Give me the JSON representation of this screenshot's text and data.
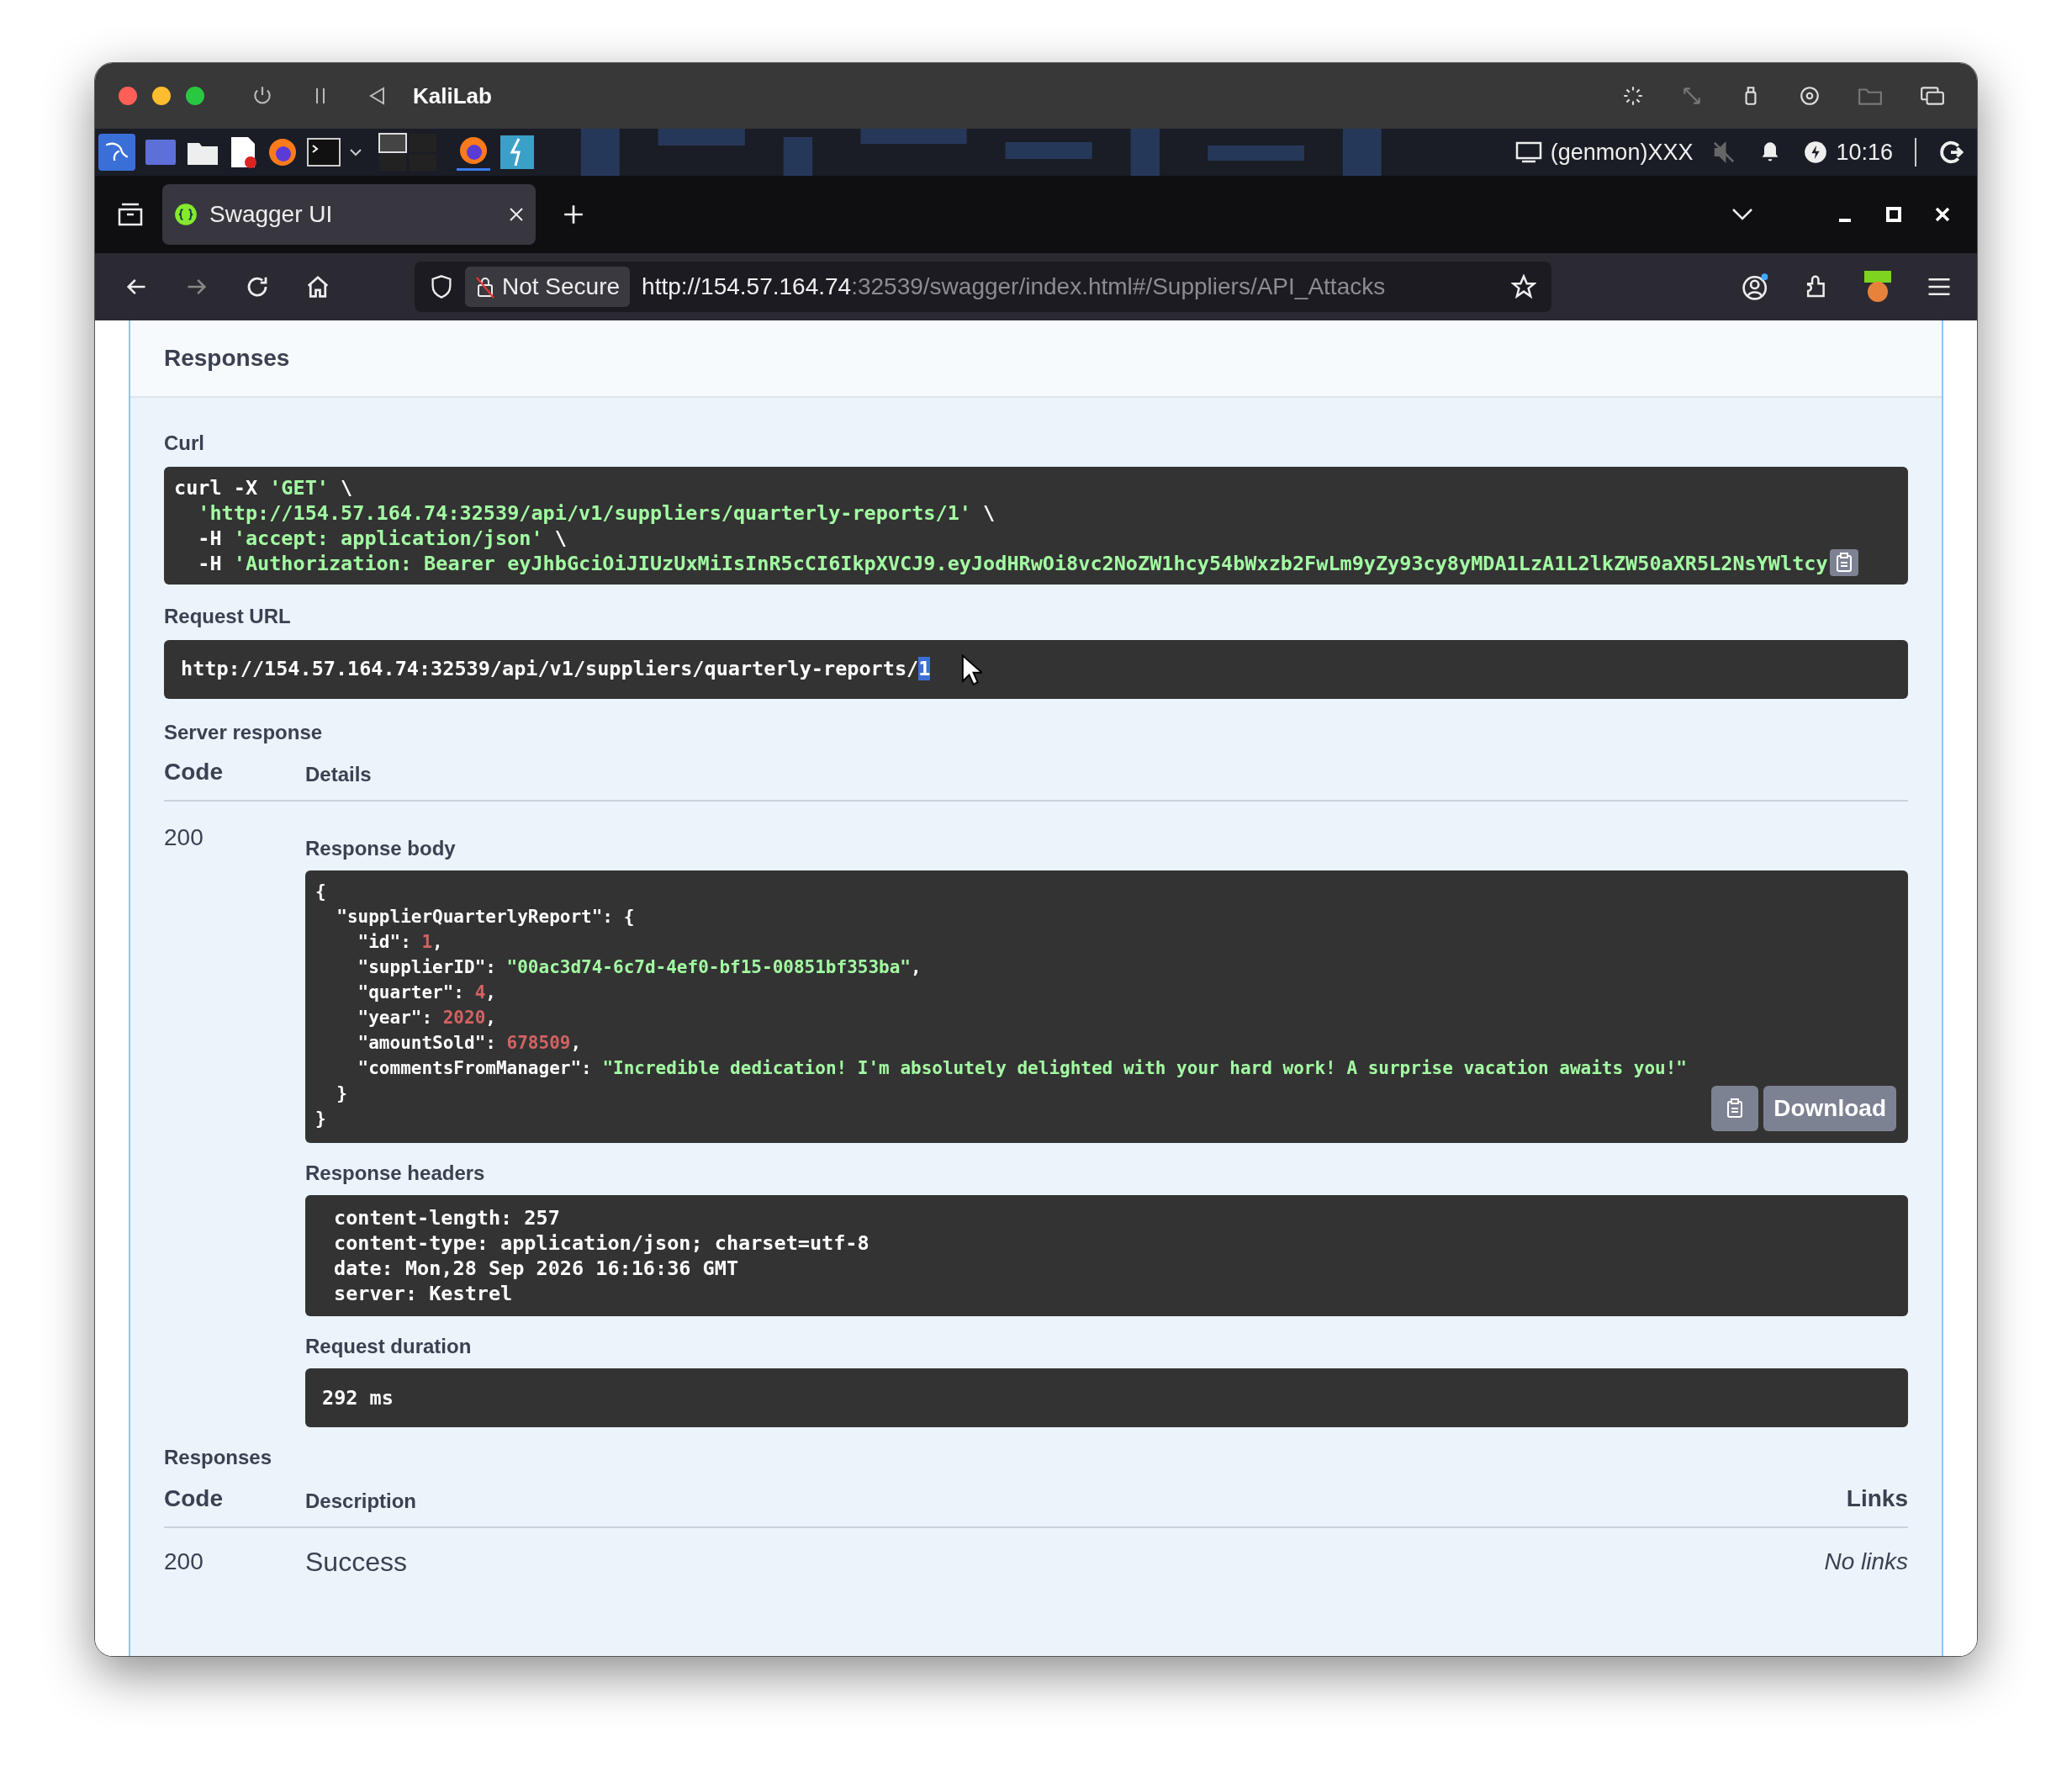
{
  "window": {
    "title": "KaliLab"
  },
  "taskbar": {
    "indicator": "(genmon)XXX",
    "clock": "10:16"
  },
  "browser": {
    "tabs": [
      {
        "title": "Swagger UI",
        "selected": true
      }
    ],
    "url": {
      "security": "Not Secure",
      "host": "http://154.57.164.74",
      "rest": ":32539/swagger/index.html#/Suppliers/API_Attacks"
    }
  },
  "section_title": "Responses",
  "curl": {
    "label": "Curl",
    "lines": [
      [
        {
          "text": "curl -X ",
          "kind": "plain"
        },
        {
          "text": "'GET'",
          "kind": "string"
        },
        {
          "text": " \\",
          "kind": "plain"
        }
      ],
      [
        {
          "text": "  'http://154.57.164.74:32539/api/v1/suppliers/quarterly-reports/1'",
          "kind": "string"
        },
        {
          "text": " \\",
          "kind": "plain"
        }
      ],
      [
        {
          "text": "  -H ",
          "kind": "plain"
        },
        {
          "text": "'accept: application/json'",
          "kind": "string"
        },
        {
          "text": " \\",
          "kind": "plain"
        }
      ],
      [
        {
          "text": "  -H ",
          "kind": "plain"
        },
        {
          "text": "'Authorization: Bearer eyJhbGciOiJIUzUxMiIsInR5cCI6IkpXVCJ9.eyJodHRwOi8vc2NoZW1hcy54bWxzb2FwLm9yZy93cy8yMDA1LzA1L2lkZW50aXR5L2NsYWltcy",
          "kind": "string"
        }
      ]
    ]
  },
  "request_url": {
    "label": "Request URL",
    "parts": [
      {
        "text": "http://154.57.164.74:32539/api/v1/suppliers/quarterly-reports/",
        "selected": false
      },
      {
        "text": "1",
        "selected": true
      }
    ]
  },
  "server_response": {
    "label": "Server response",
    "columns": [
      "Code",
      "Details"
    ],
    "code": "200",
    "body": {
      "label": "Response body",
      "download": "Download",
      "lines": [
        [
          {
            "text": "{",
            "kind": "plain"
          }
        ],
        [
          {
            "text": "  \"supplierQuarterlyReport\": {",
            "kind": "plain"
          }
        ],
        [
          {
            "text": "    \"id\": ",
            "kind": "plain"
          },
          {
            "text": "1",
            "kind": "number"
          },
          {
            "text": ",",
            "kind": "plain"
          }
        ],
        [
          {
            "text": "    \"supplierID\": ",
            "kind": "plain"
          },
          {
            "text": "\"00ac3d74-6c7d-4ef0-bf15-00851bf353ba\"",
            "kind": "string"
          },
          {
            "text": ",",
            "kind": "plain"
          }
        ],
        [
          {
            "text": "    \"quarter\": ",
            "kind": "plain"
          },
          {
            "text": "4",
            "kind": "number"
          },
          {
            "text": ",",
            "kind": "plain"
          }
        ],
        [
          {
            "text": "    \"year\": ",
            "kind": "plain"
          },
          {
            "text": "2020",
            "kind": "number"
          },
          {
            "text": ",",
            "kind": "plain"
          }
        ],
        [
          {
            "text": "    \"amountSold\": ",
            "kind": "plain"
          },
          {
            "text": "678509",
            "kind": "number"
          },
          {
            "text": ",",
            "kind": "plain"
          }
        ],
        [
          {
            "text": "    \"commentsFromManager\": ",
            "kind": "plain"
          },
          {
            "text": "\"Incredible dedication! I'm absolutely delighted with your hard work! A surprise vacation awaits you!\"",
            "kind": "string"
          }
        ],
        [
          {
            "text": "  }",
            "kind": "plain"
          }
        ],
        [
          {
            "text": "}",
            "kind": "plain"
          }
        ]
      ]
    },
    "headers": {
      "label": "Response headers",
      "lines": [
        "content-length: 257",
        "content-type: application/json; charset=utf-8",
        "date: Mon,28 Sep 2026 16:16:36 GMT",
        "server: Kestrel"
      ]
    },
    "duration": {
      "label": "Request duration",
      "value": "292 ms"
    }
  },
  "responses": {
    "label": "Responses",
    "columns": [
      "Code",
      "Description",
      "Links"
    ],
    "rows": [
      {
        "code": "200",
        "description": "Success",
        "links": "No links"
      }
    ]
  }
}
